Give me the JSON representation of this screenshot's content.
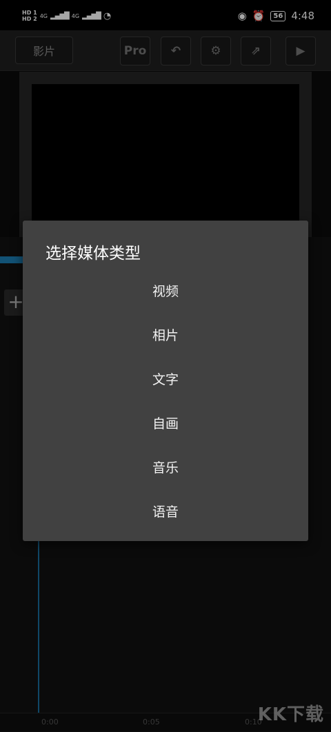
{
  "status_bar": {
    "hd1": "HD 1",
    "hd2": "HD 2",
    "signal1": "4G",
    "signal2": "4G",
    "battery": "56",
    "time": "4:48"
  },
  "toolbar": {
    "back_label": "影片",
    "pro_label": "Pro"
  },
  "timeline": {
    "ticks": [
      "0:00",
      "0:05",
      "0:10"
    ]
  },
  "watermark": "KK下载",
  "dialog": {
    "title": "选择媒体类型",
    "items": [
      "视频",
      "相片",
      "文字",
      "自画",
      "音乐",
      "语音"
    ]
  }
}
